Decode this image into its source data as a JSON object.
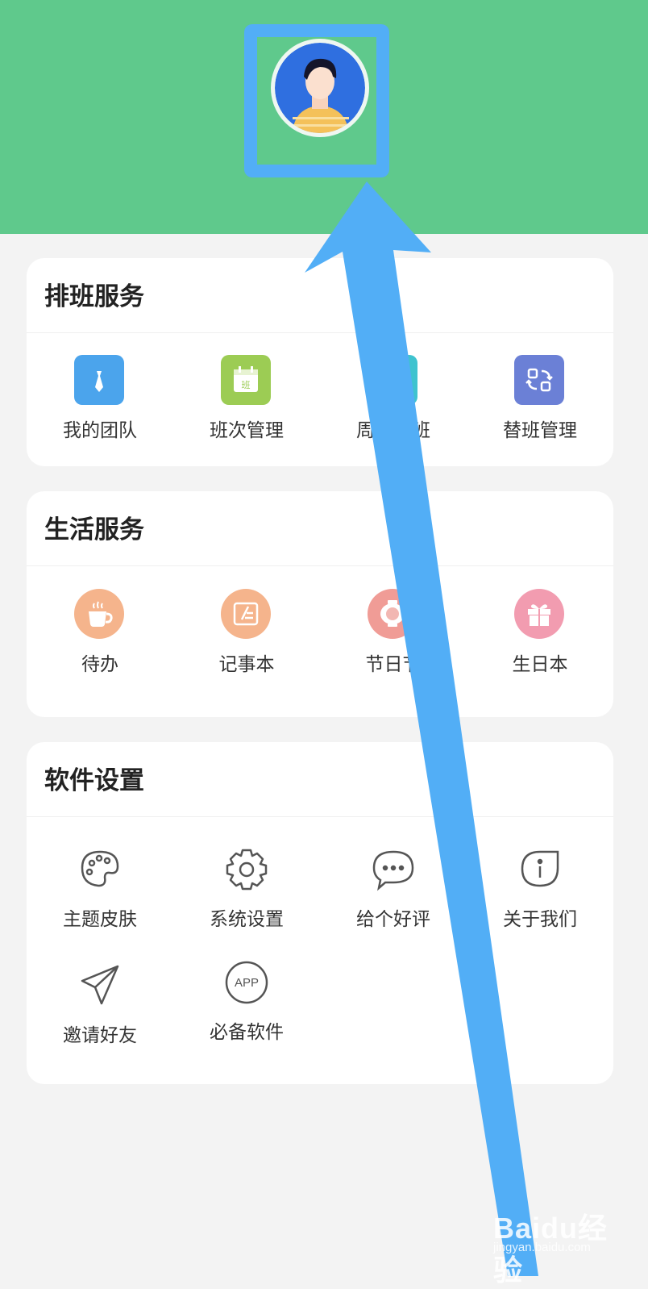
{
  "sections": [
    {
      "title": "排班服务",
      "items": [
        {
          "label": "我的团队",
          "icon": "tie-icon",
          "color": "#4ba4ec"
        },
        {
          "label": "班次管理",
          "icon": "calendar-shift-icon",
          "color": "#9ccc54"
        },
        {
          "label": "周期排班",
          "icon": "cycle-schedule-icon",
          "color": "#3ec3cf"
        },
        {
          "label": "替班管理",
          "icon": "swap-icon",
          "color": "#6b80d6"
        }
      ]
    },
    {
      "title": "生活服务",
      "items": [
        {
          "label": "待办",
          "icon": "coffee-cup-icon",
          "color": "#f5b48c"
        },
        {
          "label": "记事本",
          "icon": "notebook-icon",
          "color": "#f5b48c"
        },
        {
          "label": "节日节",
          "icon": "lantern-icon",
          "color": "#f09c96"
        },
        {
          "label": "生日本",
          "icon": "gift-icon",
          "color": "#f29cb0"
        }
      ]
    },
    {
      "title": "软件设置",
      "items": [
        {
          "label": "主题皮肤",
          "icon": "palette-icon"
        },
        {
          "label": "系统设置",
          "icon": "gear-icon"
        },
        {
          "label": "给个好评",
          "icon": "chat-bubble-icon"
        },
        {
          "label": "关于我们",
          "icon": "info-bubble-icon"
        },
        {
          "label": "邀请好友",
          "icon": "paper-plane-icon"
        },
        {
          "label": "必备软件",
          "icon": "app-badge-icon",
          "badge": "APP"
        }
      ]
    }
  ],
  "colors": {
    "header": "#5fc98c",
    "highlight": "#52aef6",
    "background": "#f3f3f3"
  },
  "watermark": {
    "brand": "Baidu经验",
    "sub": "jingyan.baidu.com"
  }
}
